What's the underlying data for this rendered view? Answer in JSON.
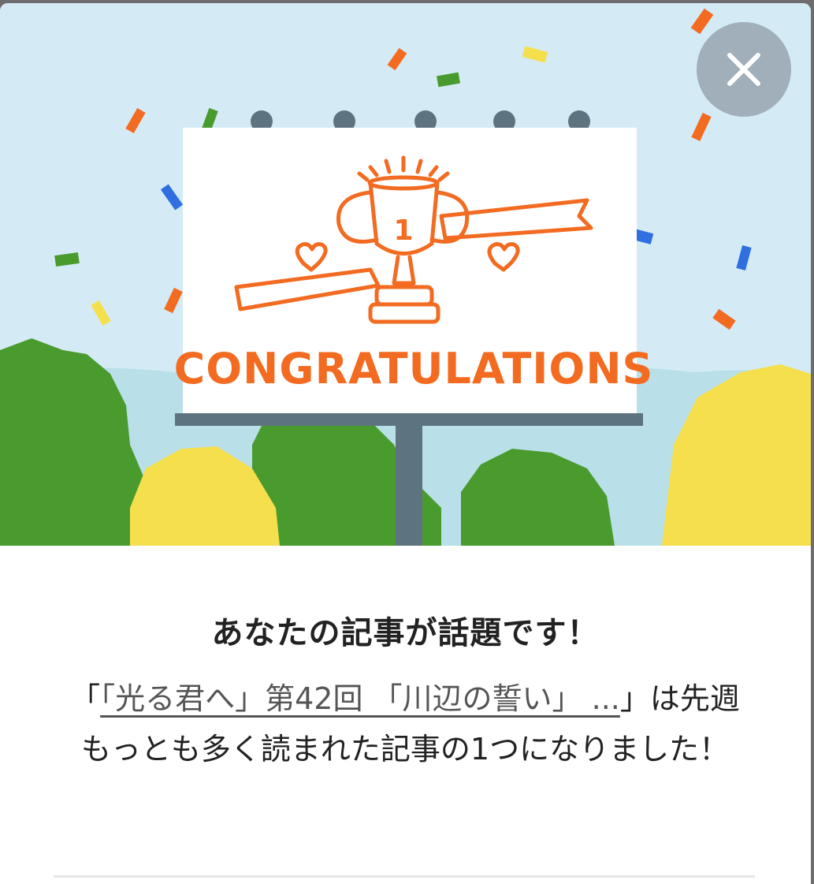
{
  "modal": {
    "close_icon": "close-icon",
    "illustration": {
      "banner_text": "CONGRATULATIONS",
      "trophy_number": "1",
      "colors": {
        "sky": "#d4ebf6",
        "accent_orange": "#f26b21",
        "tree_green": "#4a9b2e",
        "tree_yellow": "#f6df4d",
        "pole": "#5e7380"
      }
    },
    "headline": "あなたの記事が話題です！",
    "message": {
      "prefix": "「",
      "article_title": "「光る君へ」第42回 「川辺の誓い」 ...",
      "suffix": "」は先週もっとも多く読まれた記事の1つになりました！"
    }
  }
}
